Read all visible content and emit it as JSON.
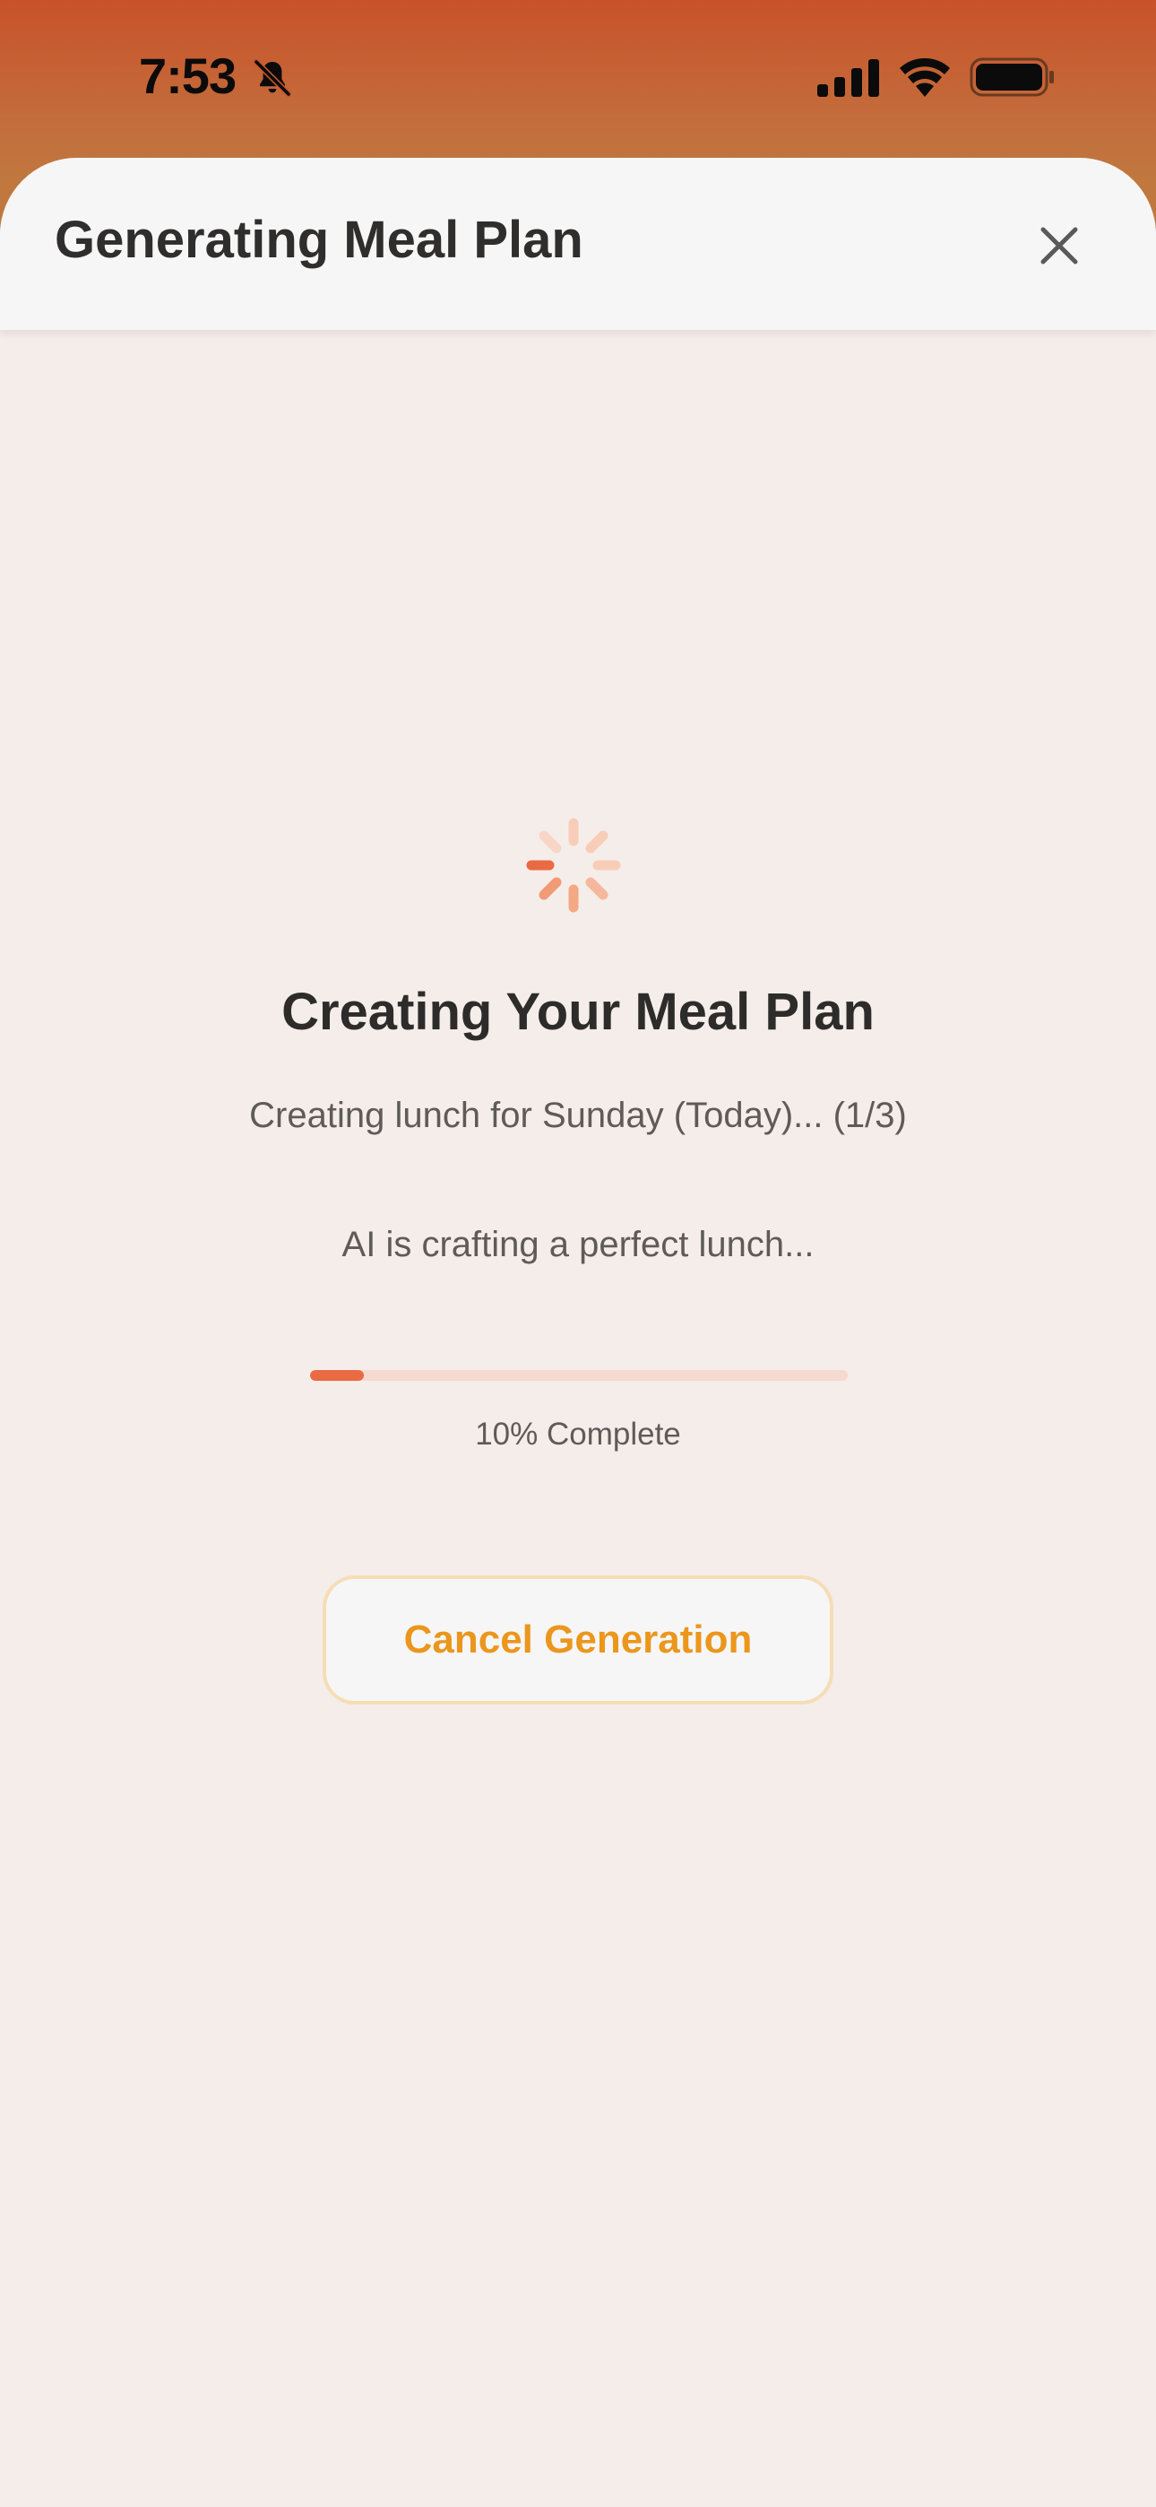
{
  "status_bar": {
    "time": "7:53",
    "icons": [
      "bell-off-icon",
      "signal-icon",
      "wifi-icon",
      "battery-icon"
    ]
  },
  "sheet": {
    "title": "Generating Meal Plan",
    "close_icon": "close-icon"
  },
  "content": {
    "spinner_icon": "spinner-icon",
    "title": "Creating Your Meal Plan",
    "step_text": "Creating lunch for Sunday (Today)... (1/3)",
    "detail_text": "AI is crafting a perfect lunch...",
    "progress_percent": 10,
    "progress_label": "10% Complete",
    "cancel_label": "Cancel Generation"
  },
  "colors": {
    "header_gradient_top": "#c8522a",
    "sheet_background": "#f5ede9",
    "accent_orange": "#ea6a43",
    "progress_track": "#f6d9cf",
    "cancel_text": "#eb961c",
    "cancel_border": "#f5ddb6"
  }
}
